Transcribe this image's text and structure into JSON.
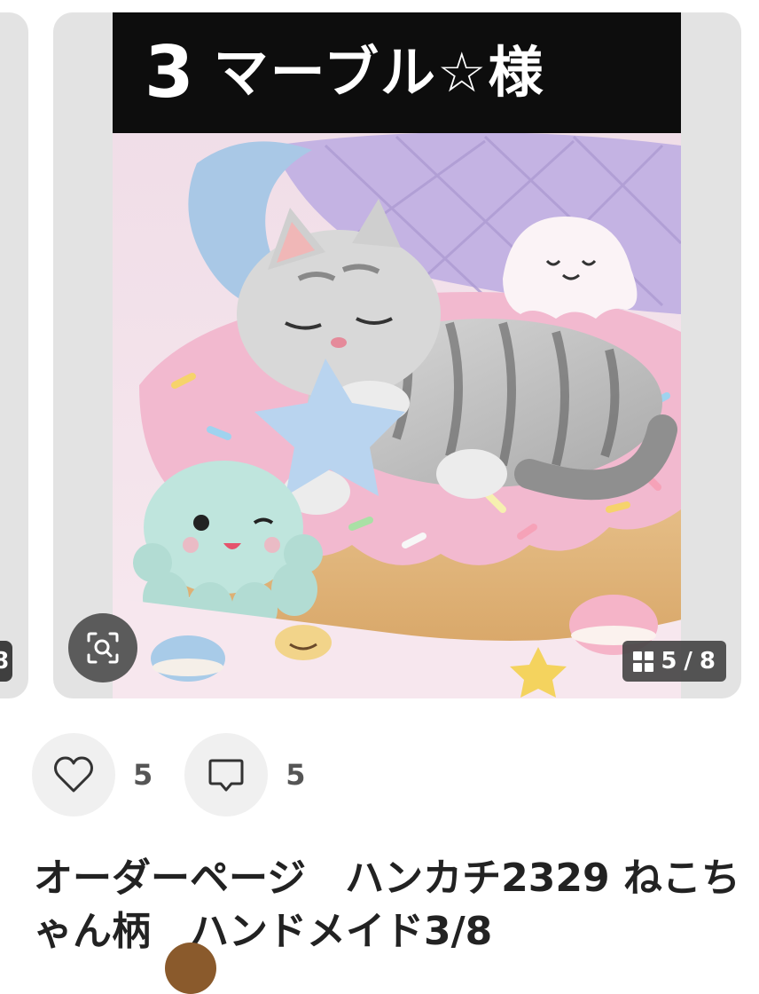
{
  "previous_card": {
    "counter_fragment": "8"
  },
  "card": {
    "banner": {
      "number": "3",
      "text": "マーブル☆様"
    },
    "image_counter": {
      "current": "5",
      "separator": "/",
      "total": "8"
    },
    "zoom_icon": "zoom-scan-icon",
    "grid_icon": "grid-icon"
  },
  "actions": {
    "like": {
      "icon": "heart-icon",
      "count": "5"
    },
    "comment": {
      "icon": "comment-icon",
      "count": "5"
    }
  },
  "product": {
    "title": "オーダーページ　ハンカチ2329 ねこちゃん柄　ハンドメイド3/8"
  },
  "colors": {
    "card_bg": "#e3e3e3",
    "banner_bg": "#0d0d0d",
    "action_bg": "#f0f0f0",
    "text": "#222222"
  }
}
